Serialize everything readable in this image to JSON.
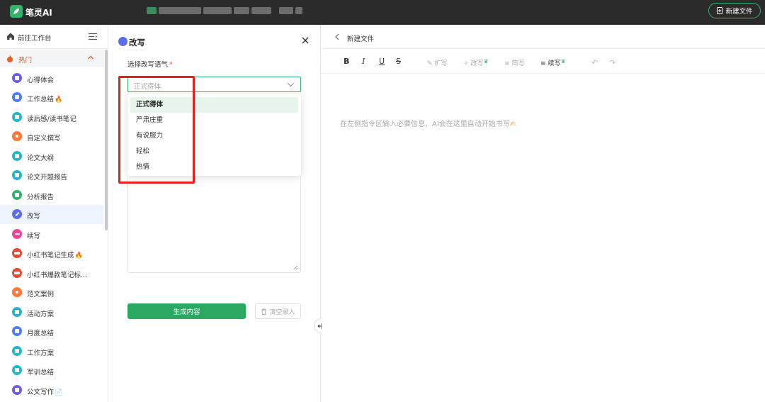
{
  "app": {
    "title": "笔灵AI",
    "new_file_label": "新建文件",
    "brand_color": "#2fb36c"
  },
  "sidebar": {
    "workspace_label": "前往工作台",
    "section_label": "热门",
    "items": [
      {
        "label": "心得体会",
        "color": "#6a5cf0",
        "hot": false,
        "active": false
      },
      {
        "label": "工作总结",
        "color": "#4c7cf3",
        "hot": true,
        "active": false
      },
      {
        "label": "读后感/读书笔记",
        "color": "#25b7c9",
        "hot": false,
        "active": false
      },
      {
        "label": "自定义撰写",
        "color": "#ff7a3d",
        "hot": false,
        "active": false
      },
      {
        "label": "论文大纲",
        "color": "#25b7c9",
        "hot": false,
        "active": false
      },
      {
        "label": "论文开题报告",
        "color": "#25b7c9",
        "hot": false,
        "active": false
      },
      {
        "label": "分析报告",
        "color": "#2fb36c",
        "hot": false,
        "active": false
      },
      {
        "label": "改写",
        "color": "#5b6cf0",
        "hot": false,
        "active": true
      },
      {
        "label": "续写",
        "color": "#ec4899",
        "hot": false,
        "active": false
      },
      {
        "label": "小红书笔记生成",
        "color": "#e8482f",
        "hot": true,
        "active": false
      },
      {
        "label": "小红书爆款笔记标...",
        "color": "#e8482f",
        "hot": false,
        "active": false
      },
      {
        "label": "范文案例",
        "color": "#ff7a3d",
        "hot": false,
        "active": false
      },
      {
        "label": "活动方案",
        "color": "#25b7c9",
        "hot": false,
        "active": false
      },
      {
        "label": "月度总结",
        "color": "#4c7cf3",
        "hot": false,
        "active": false
      },
      {
        "label": "工作方案",
        "color": "#25b7c9",
        "hot": false,
        "active": false
      },
      {
        "label": "军训总结",
        "color": "#25b7c9",
        "hot": false,
        "active": false
      },
      {
        "label": "公文写作",
        "color": "#6a5cf0",
        "hot": false,
        "active": false
      }
    ]
  },
  "panel": {
    "title": "改写",
    "field_label": "选择改写语气",
    "required_mark": "*",
    "select_placeholder": "正式得体",
    "options": [
      "正式得体",
      "严肃庄重",
      "有说服力",
      "轻松",
      "热情"
    ],
    "selected_option": "正式得体",
    "generate_label": "生成内容",
    "clear_label": "清空录入"
  },
  "editor": {
    "file_title": "新建文件",
    "toolbar": {
      "bold": "B",
      "italic": "I",
      "underline": "U",
      "strike": "S",
      "expand": "扩写",
      "rewrite": "改写",
      "simplify": "简写",
      "continue": "续写"
    },
    "placeholder": "在左侧指令区输入必要信息，AI会在这里自动开始书写"
  }
}
